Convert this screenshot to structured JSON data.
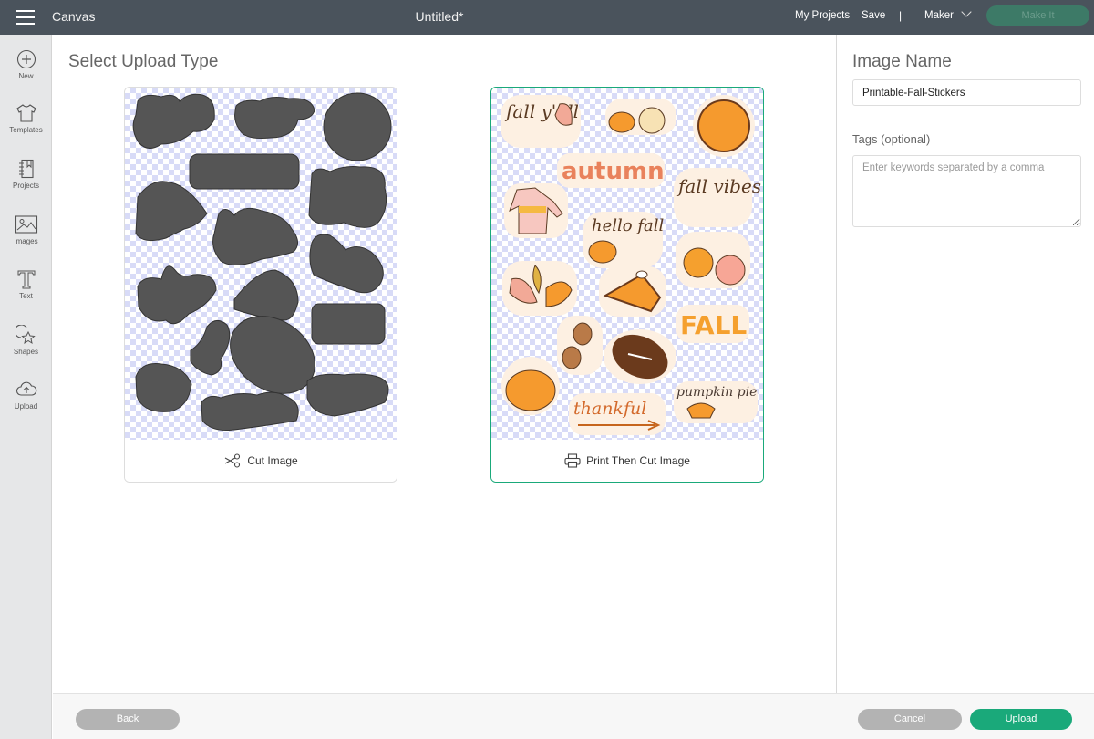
{
  "topbar": {
    "app_title": "Canvas",
    "doc_title": "Untitled*",
    "my_projects": "My Projects",
    "save": "Save",
    "separator": "|",
    "machine": "Maker",
    "make_it": "Make It"
  },
  "sidebar": {
    "items": [
      {
        "label": "New",
        "icon": "plus-circle-icon"
      },
      {
        "label": "Templates",
        "icon": "tshirt-icon"
      },
      {
        "label": "Projects",
        "icon": "notebook-icon"
      },
      {
        "label": "Images",
        "icon": "image-icon"
      },
      {
        "label": "Text",
        "icon": "text-icon"
      },
      {
        "label": "Shapes",
        "icon": "shapes-icon"
      },
      {
        "label": "Upload",
        "icon": "cloud-upload-icon"
      }
    ]
  },
  "main": {
    "title": "Select Upload Type",
    "options": [
      {
        "label": "Cut Image",
        "icon": "scissors-icon",
        "selected": false
      },
      {
        "label": "Print Then Cut Image",
        "icon": "printer-icon",
        "selected": true
      }
    ],
    "stickers": [
      "fall y'all",
      "pumpkins",
      "pie",
      "autumn",
      "fall vibes",
      "sweater",
      "hello fall",
      "apples",
      "leaves",
      "pie slice",
      "FALL",
      "acorns",
      "football",
      "pumpkin",
      "thankful",
      "pumpkin pie"
    ]
  },
  "right_panel": {
    "title": "Image Name",
    "image_name_value": "Printable-Fall-Stickers",
    "tags_label": "Tags (optional)",
    "tags_placeholder": "Enter keywords separated by a comma",
    "tags_value": ""
  },
  "footer": {
    "back": "Back",
    "cancel": "Cancel",
    "upload": "Upload"
  },
  "colors": {
    "topbar": "#4a535c",
    "accent": "#1aa97a",
    "make_it_disabled": "#3d7a67",
    "button_gray": "#b3b3b3",
    "checker": "#d8dbf7",
    "silhouette": "#555555"
  }
}
